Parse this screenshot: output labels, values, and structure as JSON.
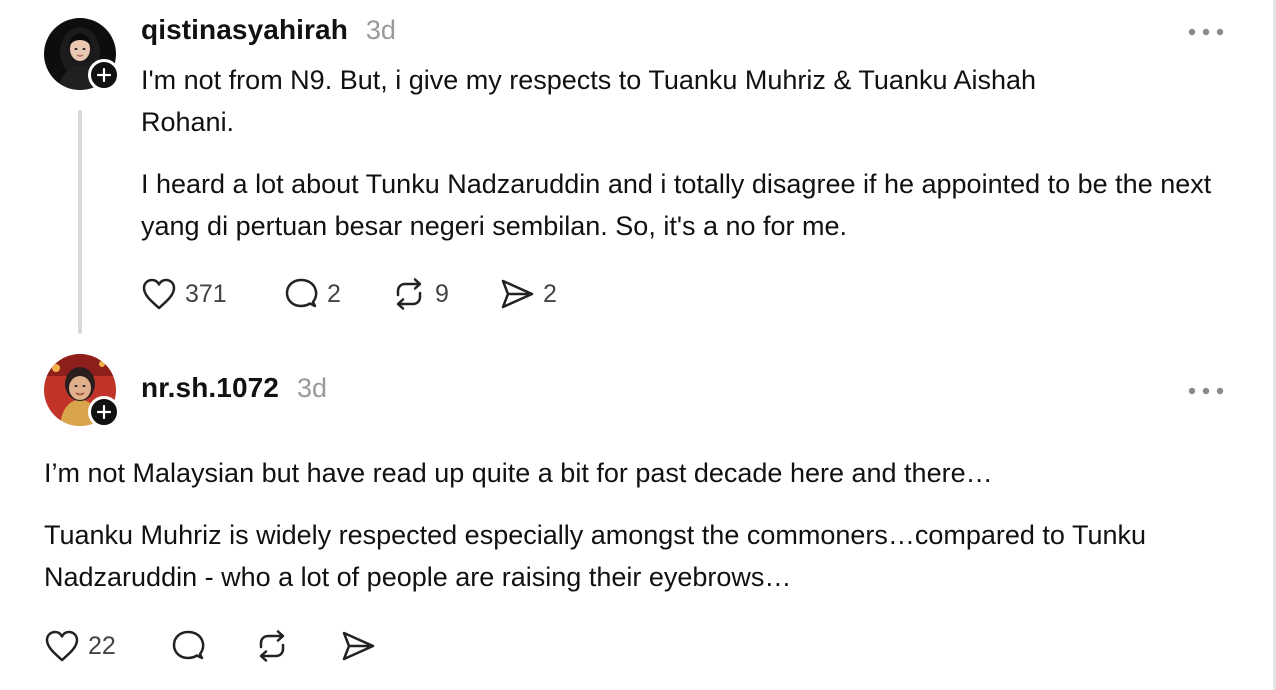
{
  "posts": [
    {
      "username": "qistinasyahirah",
      "time": "3d",
      "paragraphs": [
        "I'm not from N9. But, i give my respects to Tuanku Muhriz & Tuanku Aishah Rohani.",
        "I heard a lot about Tunku Nadzaruddin and i totally disagree if he appointed to be the next yang di pertuan besar negeri sembilan. So, it's a no for me."
      ],
      "likes": "371",
      "replies": "2",
      "reposts": "9",
      "shares": "2"
    },
    {
      "username": "nr.sh.1072",
      "time": "3d",
      "paragraphs": [
        "I’m not Malaysian but have read up quite a bit for past decade here and there…",
        "Tuanku Muhriz is widely respected especially amongst the commoners…compared to Tunku Nadzaruddin - who a lot of people are raising their eyebrows…"
      ],
      "likes": "22",
      "replies": "",
      "reposts": "",
      "shares": ""
    }
  ],
  "icons": {
    "like": "heart-icon",
    "reply": "comment-icon",
    "repost": "repost-icon",
    "share": "share-icon",
    "more": "more-options-icon",
    "follow": "plus-icon"
  },
  "colors": {
    "text": "#111111",
    "muted": "#9a9a9a",
    "thread_line": "#d9d9d9"
  }
}
